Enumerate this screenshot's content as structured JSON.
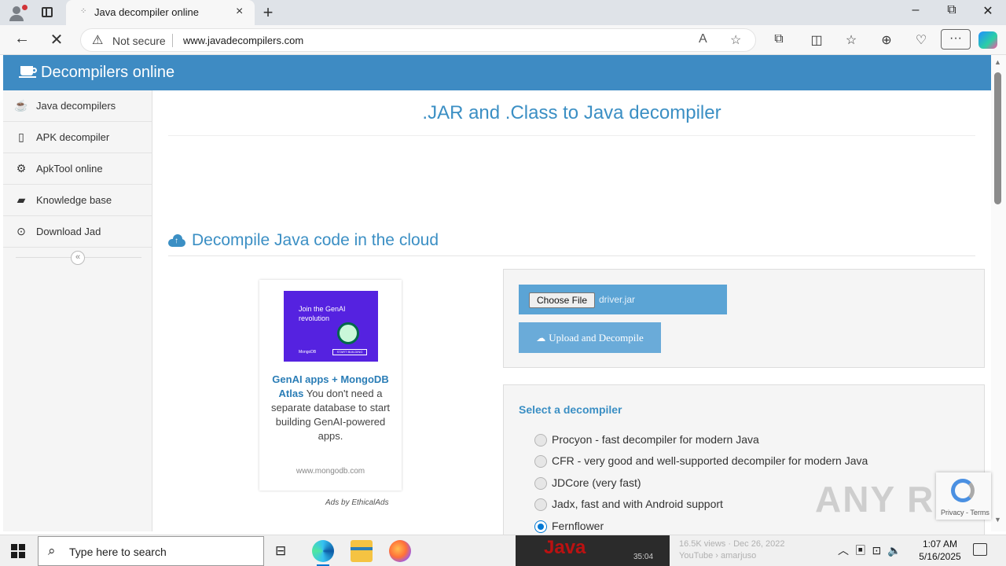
{
  "browser": {
    "tab_title": "Java decompiler online",
    "tab_close": "×",
    "new_tab": "+",
    "security_label": "Not secure",
    "url": "www.javadecompilers.com",
    "more_label": "···",
    "window_controls": {
      "minimize": "–",
      "restore": "⧉",
      "close": "✕"
    }
  },
  "header": {
    "brand": "Decompilers online"
  },
  "sidebar": {
    "items": [
      {
        "label": "Java decompilers",
        "icon": "coffee-cup-icon"
      },
      {
        "label": "APK decompiler",
        "icon": "mobile-phone-icon"
      },
      {
        "label": "ApkTool online",
        "icon": "gear-icon"
      },
      {
        "label": "Knowledge base",
        "icon": "book-icon"
      },
      {
        "label": "Download Jad",
        "icon": "download-circle-icon"
      }
    ],
    "collapse": "«"
  },
  "main": {
    "title": ".JAR and .Class to Java decompiler",
    "section_title": "Decompile Java code in the cloud"
  },
  "ad": {
    "image_headline": "Join the GenAI revolution",
    "image_brand": "MongoDB",
    "image_cta": "START BUILDING",
    "link_text": "GenAI apps + MongoDB Atlas",
    "body": "You don't need a separate database to start building GenAI-powered apps.",
    "domain": "www.mongodb.com",
    "by": "Ads by EthicalAds"
  },
  "upload": {
    "choose_label": "Choose File",
    "file_name": "driver.jar",
    "submit_label": "Upload and Decompile"
  },
  "decompiler": {
    "header": "Select a decompiler",
    "options": [
      {
        "label": "Procyon - fast decompiler for modern Java",
        "selected": false
      },
      {
        "label": "CFR - very good and well-supported decompiler for modern Java",
        "selected": false
      },
      {
        "label": "JDCore (very fast)",
        "selected": false
      },
      {
        "label": "Jadx, fast and with Android support",
        "selected": false
      },
      {
        "label": "Fernflower",
        "selected": true
      }
    ]
  },
  "recaptcha": {
    "links": "Privacy - Terms"
  },
  "watermark": "ANY RUN",
  "taskbar": {
    "search_placeholder": "Type here to search",
    "thumb_duration": "35:04",
    "thumb_caption_line1": "16.5K views · Dec 26, 2022",
    "thumb_caption_line2": "YouTube › amarjuso",
    "time": "1:07 AM",
    "date": "5/16/2025"
  },
  "colors": {
    "accent": "#3e8bc3",
    "link": "#3b8fc4",
    "upload_button": "#6aabd9"
  }
}
